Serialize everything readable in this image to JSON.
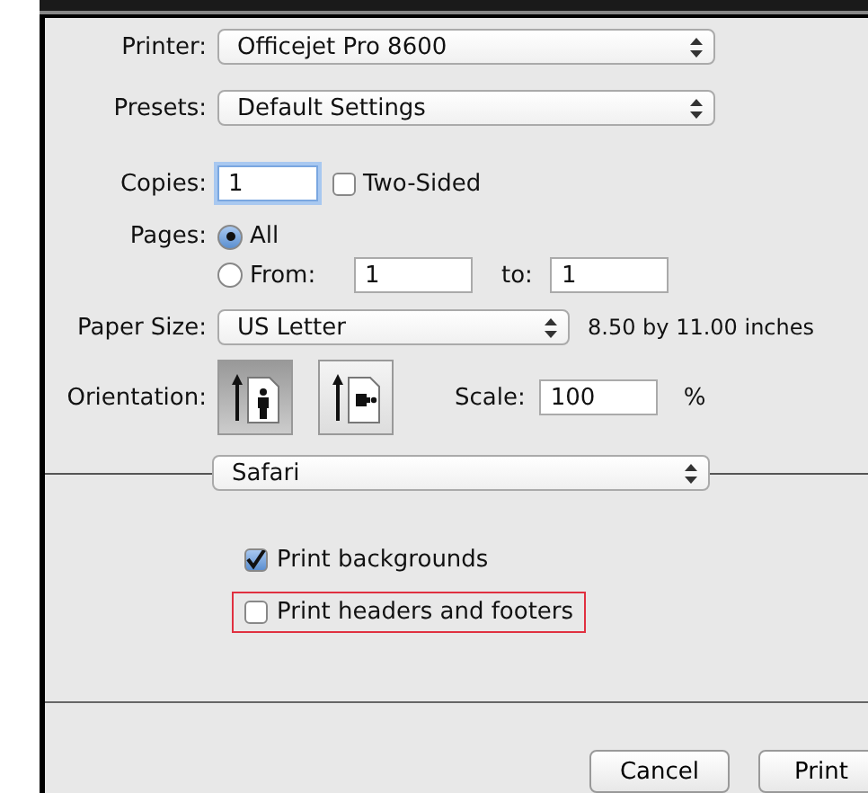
{
  "printer": {
    "label": "Printer:",
    "value": "Officejet Pro 8600"
  },
  "presets": {
    "label": "Presets:",
    "value": "Default Settings"
  },
  "copies": {
    "label": "Copies:",
    "value": "1",
    "two_sided": {
      "label": "Two-Sided",
      "checked": false
    }
  },
  "pages": {
    "label": "Pages:",
    "options": [
      {
        "label": "All",
        "selected": true
      },
      {
        "label": "From:",
        "selected": false
      }
    ],
    "from": "1",
    "to_label": "to:",
    "to": "1"
  },
  "paper_size": {
    "label": "Paper Size:",
    "value": "US Letter",
    "dimensions": "8.50 by 11.00 inches"
  },
  "orientation": {
    "label": "Orientation:",
    "options": [
      {
        "kind": "portrait",
        "selected": true
      },
      {
        "kind": "landscape",
        "selected": false
      }
    ]
  },
  "scale": {
    "label": "Scale:",
    "value": "100",
    "unit": "%"
  },
  "section": {
    "value": "Safari"
  },
  "options": [
    {
      "label": "Print backgrounds",
      "checked": true,
      "highlighted": false
    },
    {
      "label": "Print headers and footers",
      "checked": false,
      "highlighted": true
    }
  ],
  "buttons": [
    {
      "label": "Cancel"
    },
    {
      "label": "Print"
    }
  ]
}
